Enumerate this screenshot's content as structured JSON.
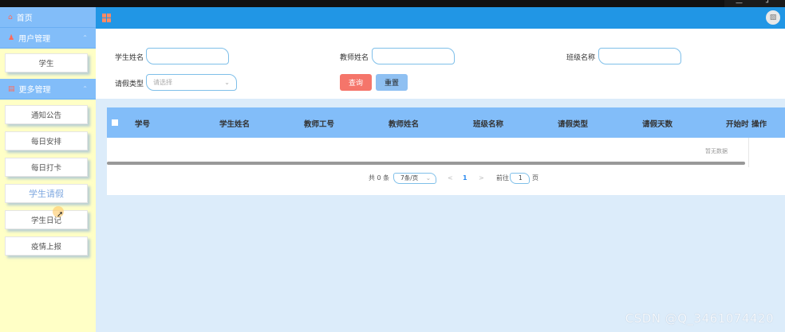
{
  "sidebar": {
    "home": {
      "label": "首页",
      "icon": "home-icon"
    },
    "user_mgmt": {
      "label": "用户管理",
      "icon": "user-icon",
      "chevron": "⌃"
    },
    "user_items": [
      {
        "label": "学生"
      }
    ],
    "more_mgmt": {
      "label": "更多管理",
      "icon": "list-icon",
      "chevron": "⌃"
    },
    "more_items": [
      {
        "label": "通知公告"
      },
      {
        "label": "每日安排"
      },
      {
        "label": "每日打卡"
      },
      {
        "label": "学生请假",
        "active": true
      },
      {
        "label": "学生日记"
      },
      {
        "label": "疫情上报"
      }
    ]
  },
  "search": {
    "student_name_label": "学生姓名",
    "teacher_name_label": "教师姓名",
    "class_name_label": "班级名称",
    "leave_type_label": "请假类型",
    "leave_type_placeholder": "请选择",
    "query_button": "查询",
    "reset_button": "重置"
  },
  "table": {
    "columns": [
      "学号",
      "学生姓名",
      "教师工号",
      "教师姓名",
      "班级名称",
      "请假类型",
      "请假天数",
      "开始时",
      "操作"
    ],
    "empty_text": "暂无数据"
  },
  "pagination": {
    "total_text": "共 0 条",
    "page_size": "7条/页",
    "prev": "<",
    "current_page": "1",
    "next": ">",
    "goto_label": "前往",
    "goto_value": "1",
    "page_suffix": "页"
  },
  "watermark": "CSDN @Q_3461074420",
  "colors": {
    "header_blue": "#2196e5",
    "sidebar_bg": "#ffffc6",
    "table_header": "#82bdf9",
    "query_red": "#f5756a",
    "reset_blue": "#8fc0f2"
  }
}
